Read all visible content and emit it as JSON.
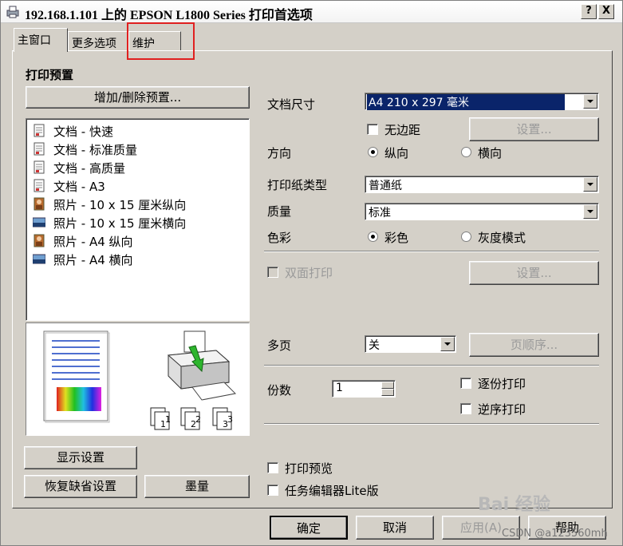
{
  "window": {
    "title": "192.168.1.101 上的 EPSON L1800 Series 打印首选项",
    "help_btn": "?",
    "close_btn": "X"
  },
  "tabs": [
    {
      "label": "主窗口"
    },
    {
      "label": "更多选项"
    },
    {
      "label": "维护"
    }
  ],
  "presets": {
    "heading": "打印预置",
    "add_remove_button": "增加/删除预置...",
    "items": [
      {
        "label": "文档 - 快速",
        "icon": "document-icon"
      },
      {
        "label": "文档 - 标准质量",
        "icon": "document-icon"
      },
      {
        "label": "文档 - 高质量",
        "icon": "document-icon"
      },
      {
        "label": "文档 - A3",
        "icon": "document-icon"
      },
      {
        "label": "照片 - 10 x 15 厘米纵向",
        "icon": "photo-portrait-icon"
      },
      {
        "label": "照片 - 10 x 15 厘米横向",
        "icon": "photo-landscape-icon"
      },
      {
        "label": "照片 - A4 纵向",
        "icon": "photo-portrait-icon"
      },
      {
        "label": "照片 - A4 横向",
        "icon": "photo-landscape-icon"
      }
    ]
  },
  "settings": {
    "doc_size_label": "文档尺寸",
    "doc_size_value": "A4 210 x 297 毫米",
    "borderless_label": "无边距",
    "borderless_settings_button": "设置...",
    "orientation_label": "方向",
    "portrait_label": "纵向",
    "landscape_label": "横向",
    "paper_type_label": "打印纸类型",
    "paper_type_value": "普通纸",
    "quality_label": "质量",
    "quality_value": "标准",
    "color_label": "色彩",
    "color_option": "彩色",
    "grayscale_option": "灰度模式",
    "duplex_label": "双面打印",
    "duplex_settings_button": "设置...",
    "multipage_label": "多页",
    "multipage_value": "关",
    "page_order_button": "页顺序...",
    "copies_label": "份数",
    "copies_value": "1",
    "collate_label": "逐份打印",
    "reverse_label": "逆序打印",
    "print_preview_label": "打印预览",
    "job_arranger_label": "任务编辑器Lite版"
  },
  "buttons": {
    "show_settings": "显示设置",
    "restore_defaults": "恢复缺省设置",
    "ink_levels": "墨量",
    "ok": "确定",
    "cancel": "取消",
    "apply": "应用(A)",
    "help": "帮助"
  },
  "watermarks": {
    "baidu": "Bai 经验",
    "csdn": "CSDN @a123560mh"
  }
}
